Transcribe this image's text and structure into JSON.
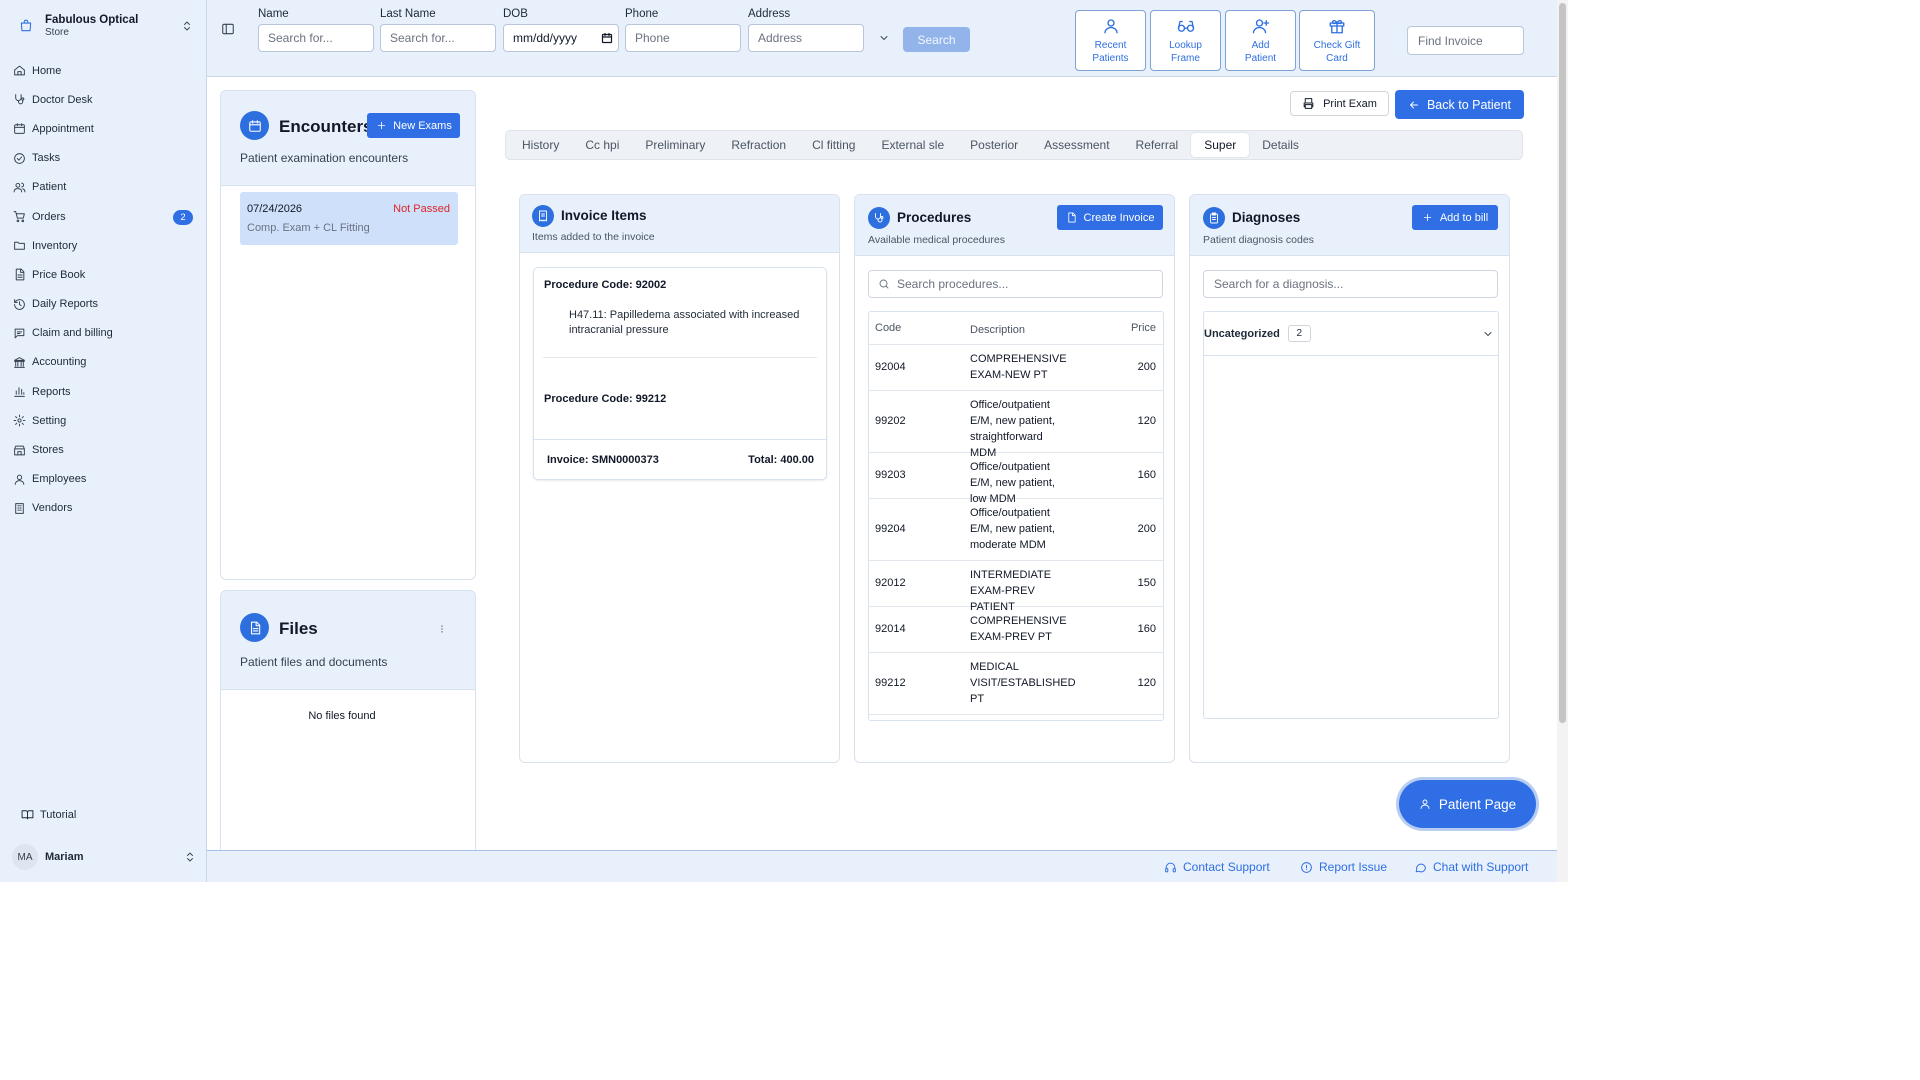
{
  "store": {
    "name": "Fabulous Optical",
    "sub": "Store"
  },
  "sidebar": {
    "items": [
      {
        "label": "Home",
        "icon": "home-icon"
      },
      {
        "label": "Doctor Desk",
        "icon": "stethoscope-icon"
      },
      {
        "label": "Appointment",
        "icon": "calendar-icon"
      },
      {
        "label": "Tasks",
        "icon": "check-circle-icon"
      },
      {
        "label": "Patient",
        "icon": "users-icon"
      },
      {
        "label": "Orders",
        "icon": "cart-icon",
        "badge": "2"
      },
      {
        "label": "Inventory",
        "icon": "folder-icon"
      },
      {
        "label": "Price Book",
        "icon": "file-icon"
      },
      {
        "label": "Daily Reports",
        "icon": "history-icon"
      },
      {
        "label": "Claim and billing",
        "icon": "message-icon"
      },
      {
        "label": "Accounting",
        "icon": "landmark-icon"
      },
      {
        "label": "Reports",
        "icon": "bar-chart-icon"
      },
      {
        "label": "Setting",
        "icon": "gear-icon"
      },
      {
        "label": "Stores",
        "icon": "store-icon"
      },
      {
        "label": "Employees",
        "icon": "user-icon"
      },
      {
        "label": "Vendors",
        "icon": "building-icon"
      }
    ],
    "tutorial": "Tutorial",
    "user": {
      "initials": "MA",
      "name": "Mariam"
    }
  },
  "search": {
    "name": {
      "label": "Name",
      "placeholder": "Search for..."
    },
    "last_name": {
      "label": "Last Name",
      "placeholder": "Search for..."
    },
    "dob": {
      "label": "DOB",
      "value": "mm/dd/yyyy"
    },
    "phone": {
      "label": "Phone",
      "placeholder": "Phone"
    },
    "address": {
      "label": "Address",
      "placeholder": "Address"
    },
    "button": "Search"
  },
  "quick_actions": [
    {
      "line1": "Recent",
      "line2": "Patients",
      "icon": "user-icon"
    },
    {
      "line1": "Lookup",
      "line2": "Frame",
      "icon": "glasses-icon"
    },
    {
      "line1": "Add",
      "line2": "Patient",
      "icon": "user-plus-icon"
    },
    {
      "line1": "Check Gift",
      "line2": "Card",
      "icon": "gift-icon"
    }
  ],
  "find_invoice": {
    "placeholder": "Find Invoice"
  },
  "encounters": {
    "title": "Encounters",
    "subtitle": "Patient examination encounters",
    "new_button": "New Exams",
    "items": [
      {
        "date": "07/24/2026",
        "status": "Not Passed",
        "type": "Comp. Exam + CL Fitting"
      }
    ]
  },
  "files": {
    "title": "Files",
    "subtitle": "Patient files and documents",
    "empty": "No files found"
  },
  "exam_actions": {
    "print": "Print Exam",
    "back": "Back to Patient"
  },
  "tabs": [
    "History",
    "Cc hpi",
    "Preliminary",
    "Refraction",
    "Cl fitting",
    "External sle",
    "Posterior",
    "Assessment",
    "Referral",
    "Super",
    "Details"
  ],
  "active_tab": "Super",
  "invoice_items": {
    "title": "Invoice Items",
    "subtitle": "Items added to the invoice",
    "codes": [
      {
        "label": "Procedure Code: 92002",
        "diagnosis": "H47.11: Papilledema associated with increased intracranial pressure"
      },
      {
        "label": "Procedure Code: 99212"
      }
    ],
    "invoice_label": "Invoice: SMN0000373",
    "total_label": "Total: 400.00"
  },
  "procedures": {
    "title": "Procedures",
    "subtitle": "Available medical procedures",
    "create_button": "Create Invoice",
    "search_placeholder": "Search procedures...",
    "columns": [
      "Code",
      "Description",
      "Price"
    ],
    "rows": [
      {
        "code": "92004",
        "desc": "COMPREHENSIVE EXAM-NEW PT",
        "price": "200"
      },
      {
        "code": "99202",
        "desc": "Office/outpatient E/M, new patient, straightforward MDM",
        "price": "120"
      },
      {
        "code": "99203",
        "desc": "Office/outpatient E/M, new patient, low MDM",
        "price": "160"
      },
      {
        "code": "99204",
        "desc": "Office/outpatient E/M, new patient, moderate MDM",
        "price": "200"
      },
      {
        "code": "92012",
        "desc": "INTERMEDIATE EXAM-PREV PATIENT",
        "price": "150"
      },
      {
        "code": "92014",
        "desc": "COMPREHENSIVE EXAM-PREV PT",
        "price": "160"
      },
      {
        "code": "99212",
        "desc": "MEDICAL VISIT/ESTABLISHED PT",
        "price": "120"
      }
    ]
  },
  "diagnoses": {
    "title": "Diagnoses",
    "subtitle": "Patient diagnosis codes",
    "add_button": "Add to bill",
    "search_placeholder": "Search for a diagnosis...",
    "group": {
      "label": "Uncategorized",
      "count": "2"
    }
  },
  "patient_page_button": "Patient Page",
  "footer": {
    "contact": "Contact Support",
    "report": "Report Issue",
    "chat": "Chat with Support"
  },
  "colors": {
    "accent": "#2f6ee5",
    "sidebar_bg": "#e8f0fc",
    "status_fail": "#dc2626"
  }
}
